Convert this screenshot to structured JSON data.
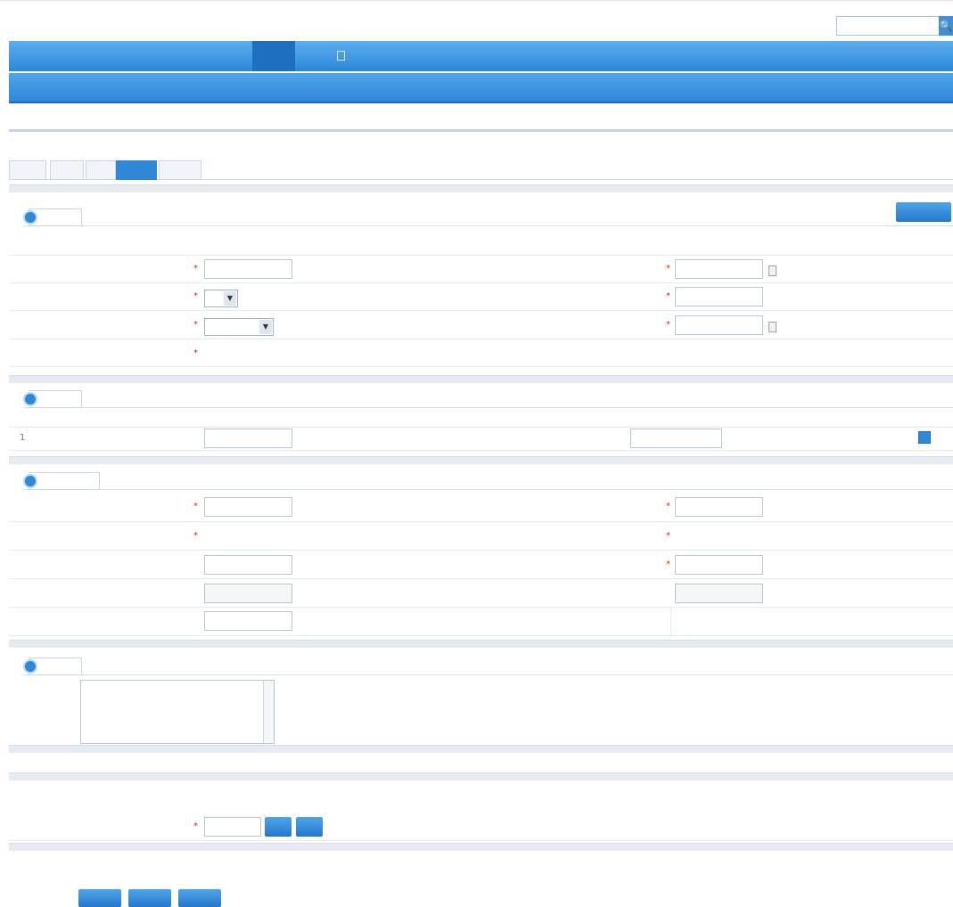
{
  "header": {
    "left_info": "",
    "search_placeholder": "",
    "search_icon": "search-icon"
  },
  "nav_main": [
    {
      "label": ""
    },
    {
      "label": ""
    },
    {
      "label": ""
    },
    {
      "label": ""
    },
    {
      "label": ""
    },
    {
      "label": ""
    },
    {
      "label": ""
    },
    {
      "label": ""
    }
  ],
  "nav_main_active": 6,
  "nav_sub": [
    {
      "label": ""
    },
    {
      "label": ""
    },
    {
      "label": ""
    },
    {
      "label": ""
    },
    {
      "label": ""
    }
  ],
  "subnav_links": [
    {
      "label": ""
    },
    {
      "label": ""
    },
    {
      "label": ""
    },
    {
      "label": ""
    },
    {
      "label": ""
    },
    {
      "label": ""
    },
    {
      "label": ""
    },
    {
      "label": ""
    },
    {
      "label": ""
    },
    {
      "label": ""
    },
    {
      "label": ""
    }
  ],
  "breadcrumb": "",
  "tabs": [
    {
      "label": ""
    },
    {
      "label": ""
    },
    {
      "label": ""
    },
    {
      "label": ""
    },
    {
      "label": ""
    }
  ],
  "active_tab": 3,
  "section1": {
    "title": "",
    "action_button": "",
    "fields": {
      "f1_label": "",
      "f1_value": "",
      "f2_label": "",
      "f2_value": "",
      "f3_label": "",
      "f3_value": "",
      "f4_label": "",
      "f4_value": "",
      "f5_label": "",
      "f5_value": "",
      "f6_label": "",
      "f6_value": "",
      "f7_label": "",
      "f7_value": "",
      "f8_label": "",
      "f8_value": "",
      "f9_label": "",
      "f9_options": ""
    }
  },
  "section2": {
    "title": "",
    "columns": [
      "",
      "",
      "",
      ""
    ],
    "rows": [
      {
        "index": "1",
        "code": "",
        "name": ""
      }
    ]
  },
  "section3": {
    "title": "",
    "fields": {
      "a_label": "",
      "a_value": "",
      "a_link": "",
      "b_label": "",
      "b_value": "",
      "c_label": "",
      "c_value": "",
      "d_label": "",
      "d_value": "",
      "e_label": "",
      "e_value": "",
      "f_label": "",
      "f_value": "",
      "g_label": "",
      "g_value": "",
      "h_label": "",
      "h_value": "",
      "i_label": "",
      "i_value": ""
    }
  },
  "section4": {
    "title": "",
    "remark_label": "",
    "remark_value": ""
  },
  "section5": {
    "title": "",
    "field_label": "",
    "field_value": "",
    "btn1": "",
    "btn2": ""
  },
  "footer_buttons": [
    {
      "label": ""
    },
    {
      "label": ""
    },
    {
      "label": ""
    }
  ]
}
